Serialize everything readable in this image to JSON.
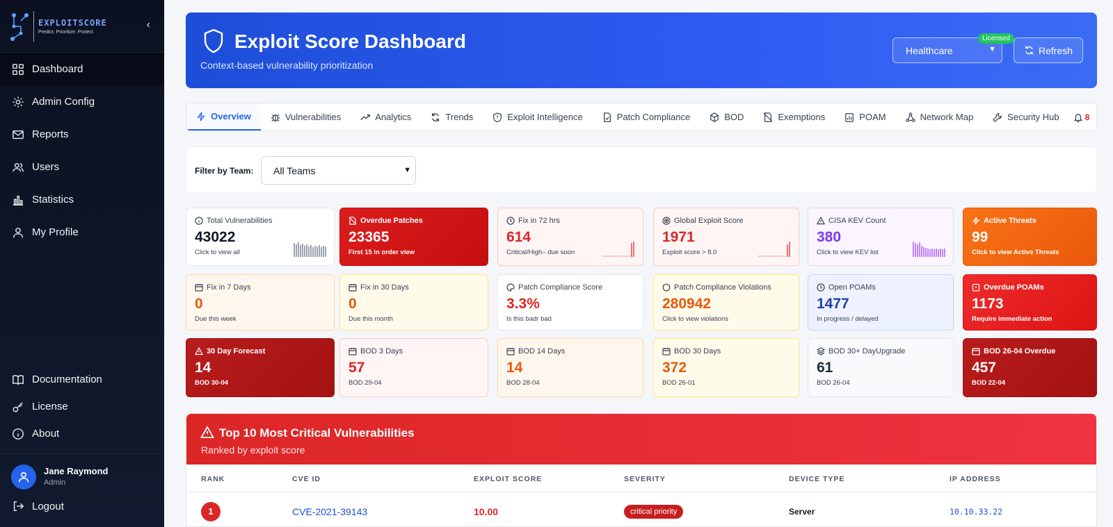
{
  "brand": {
    "name": "EXPLOITSCORE",
    "tagline": "Predict. Prioritize. Protect",
    "accent": "#2563eb"
  },
  "sidebar": {
    "items": [
      {
        "label": "Dashboard",
        "icon": "dashboard-icon",
        "active": true
      },
      {
        "label": "Admin Config",
        "icon": "gear-icon"
      },
      {
        "label": "Reports",
        "icon": "mail-icon"
      },
      {
        "label": "Users",
        "icon": "users-icon"
      },
      {
        "label": "Statistics",
        "icon": "bar-chart-icon"
      },
      {
        "label": "My Profile",
        "icon": "user-icon"
      }
    ],
    "bottom_items": [
      {
        "label": "Documentation",
        "icon": "book-icon"
      },
      {
        "label": "License",
        "icon": "key-icon"
      },
      {
        "label": "About",
        "icon": "info-icon"
      }
    ],
    "user": {
      "name": "Jane Raymond",
      "role": "Admin"
    },
    "logout_label": "Logout"
  },
  "header": {
    "title": "Exploit Score Dashboard",
    "subtitle": "Context-based vulnerability prioritization",
    "industry_selected": "Healthcare",
    "license_badge": "Licensed",
    "refresh_label": "Refresh"
  },
  "tabs": [
    {
      "label": "Overview",
      "icon": "bolt-icon",
      "active": true
    },
    {
      "label": "Vulnerabilities",
      "icon": "bug-icon"
    },
    {
      "label": "Analytics",
      "icon": "trend-up-icon"
    },
    {
      "label": "Trends",
      "icon": "refresh-icon"
    },
    {
      "label": "Exploit Intelligence",
      "icon": "shield-alert-icon"
    },
    {
      "label": "Patch Compliance",
      "icon": "file-check-icon"
    },
    {
      "label": "BOD",
      "icon": "cube-icon"
    },
    {
      "label": "Exemptions",
      "icon": "file-off-icon"
    },
    {
      "label": "POAM",
      "icon": "clipboard-chart-icon"
    },
    {
      "label": "Network Map",
      "icon": "network-icon"
    },
    {
      "label": "Security Hub",
      "icon": "tool-icon"
    }
  ],
  "notifications_count": "8",
  "filter": {
    "label": "Filter by Team:",
    "selected": "All Teams"
  },
  "cards": {
    "total_vulns": {
      "title": "Total Vulnerabilities",
      "value": "43022",
      "sub": "Click to view all"
    },
    "overdue_patches": {
      "title": "Overdue Patches",
      "value": "23365",
      "sub": "First 15 in order view"
    },
    "fix_72": {
      "title": "Fix in 72 hrs",
      "value": "614",
      "sub": "Critical/High– due soon"
    },
    "global_score": {
      "title": "Global Exploit Score",
      "value": "1971",
      "sub": "Exploit score > 8.0"
    },
    "kev": {
      "title": "CISA KEV Count",
      "value": "380",
      "sub": "Click to view KEV list"
    },
    "active_threats": {
      "title": "Active Threats",
      "value": "99",
      "sub": "Click to view Active Threats"
    },
    "fix_7": {
      "title": "Fix in 7 Days",
      "value": "0",
      "sub": "Due this week"
    },
    "fix_30": {
      "title": "Fix in 30 Days",
      "value": "0",
      "sub": "Due this month"
    },
    "patch_score": {
      "title": "Patch Compliance Score",
      "value": "3.3%",
      "sub": "Is this badr bad"
    },
    "patch_violations": {
      "title": "Patch Compliance Violations",
      "value": "280942",
      "sub": "Click to view violations"
    },
    "open_poams": {
      "title": "Open POAMs",
      "value": "1477",
      "sub": "In progress / delayed"
    },
    "overdue_poams": {
      "title": "Overdue POAMs",
      "value": "1173",
      "sub": "Require immediate action"
    },
    "forecast_30": {
      "title": "30 Day Forecast",
      "value": "14",
      "sub": "BOD 30-04"
    },
    "bod_3": {
      "title": "BOD 3 Days",
      "value": "57",
      "sub": "BOD 29-04"
    },
    "bod_14": {
      "title": "BOD 14 Days",
      "value": "14",
      "sub": "BOD 28-04"
    },
    "bod_30": {
      "title": "BOD 30 Days",
      "value": "372",
      "sub": "BOD 26-01"
    },
    "bod_30plus": {
      "title": "BOD 30+ DayUpgrade",
      "value": "61",
      "sub": "BOD 26-04"
    },
    "bod_overdue": {
      "title": "BOD 26-04 Overdue",
      "value": "457",
      "sub": "BOD 22-04"
    }
  },
  "top_ten": {
    "title": "Top 10 Most Critical Vulnerabilities",
    "subtitle": "Ranked by exploit score",
    "columns": [
      "RANK",
      "CVE ID",
      "EXPLOIT SCORE",
      "SEVERITY",
      "DEVICE TYPE",
      "IP ADDRESS"
    ],
    "rows": [
      {
        "rank": "1",
        "cve": "CVE-2021-39143",
        "score": "10.00",
        "severity": "critical priority",
        "device": "Server",
        "ip": "10.10.33.22"
      }
    ]
  }
}
